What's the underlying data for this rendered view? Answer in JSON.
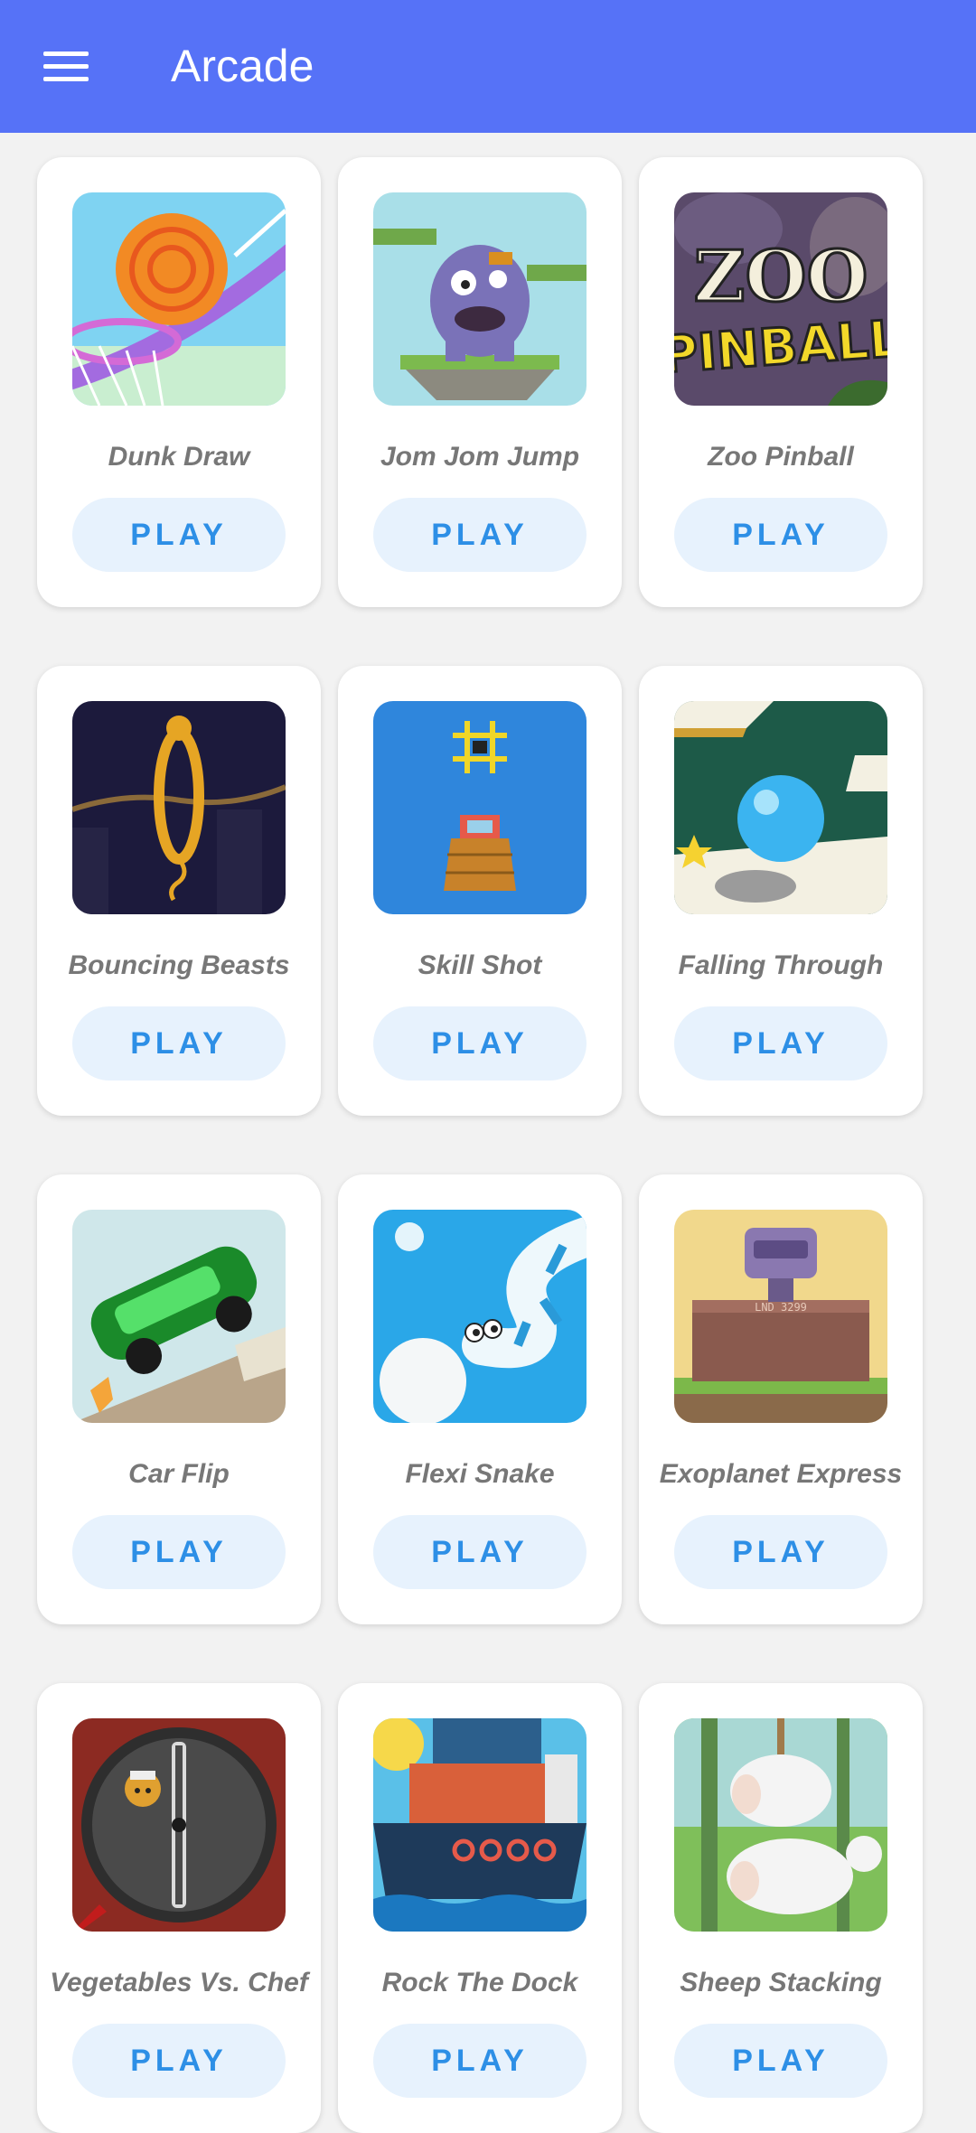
{
  "app_bar": {
    "title": "Arcade",
    "menu_icon": "hamburger-menu-icon",
    "background_color": "#5672f7"
  },
  "colors": {
    "play_button_bg": "#e7f2fd",
    "play_button_text": "#2d8fe6",
    "game_name_text": "#777777"
  },
  "games": [
    {
      "name": "Dunk Draw",
      "play_label": "PLAY",
      "art": "dunk-draw-art"
    },
    {
      "name": "Jom Jom Jump",
      "play_label": "PLAY",
      "art": "jom-jom-jump-art"
    },
    {
      "name": "Zoo Pinball",
      "play_label": "PLAY",
      "art": "zoo-pinball-art"
    },
    {
      "name": "Bouncing Beasts",
      "play_label": "PLAY",
      "art": "bouncing-beasts-art"
    },
    {
      "name": "Skill Shot",
      "play_label": "PLAY",
      "art": "skill-shot-art"
    },
    {
      "name": "Falling Through",
      "play_label": "PLAY",
      "art": "falling-through-art"
    },
    {
      "name": "Car Flip",
      "play_label": "PLAY",
      "art": "car-flip-art"
    },
    {
      "name": "Flexi Snake",
      "play_label": "PLAY",
      "art": "flexi-snake-art"
    },
    {
      "name": "Exoplanet Express",
      "play_label": "PLAY",
      "art": "exoplanet-express-art"
    },
    {
      "name": "Vegetables Vs. Chef",
      "play_label": "PLAY",
      "art": "vegetables-vs-chef-art"
    },
    {
      "name": "Rock The Dock",
      "play_label": "PLAY",
      "art": "rock-the-dock-art"
    },
    {
      "name": "Sheep Stacking",
      "play_label": "PLAY",
      "art": "sheep-stacking-art"
    }
  ]
}
